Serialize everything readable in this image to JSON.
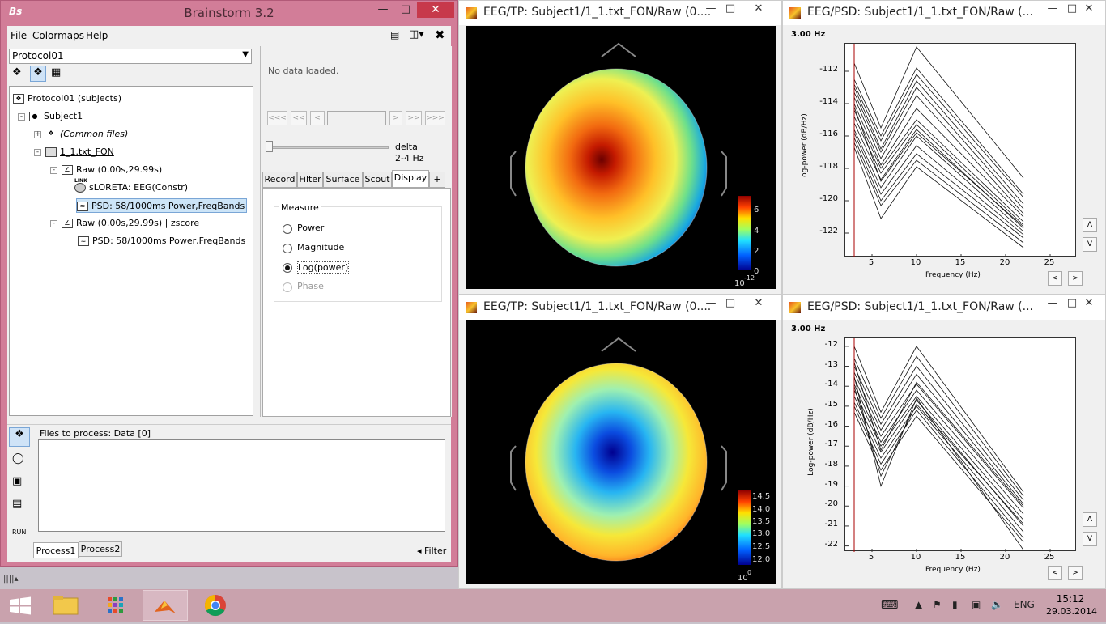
{
  "brainstorm": {
    "title": "Brainstorm 3.2",
    "menu": [
      "File",
      "Colormaps",
      "Help"
    ],
    "protocol": "Protocol01",
    "tree": {
      "root": "Protocol01 (subjects)",
      "subject": "Subject1",
      "common": "(Common files)",
      "condition": "1_1.txt_FON",
      "raw1": "Raw (0.00s,29.99s)",
      "sloreta": "sLORETA: EEG(Constr)",
      "link": "LINK",
      "psd1": "PSD: 58/1000ms Power,FreqBands",
      "raw2": "Raw (0.00s,29.99s) | zscore",
      "psd2": "PSD: 58/1000ms Power,FreqBands"
    },
    "panel": {
      "status": "No data loaded.",
      "nav": [
        "<<<",
        "<<",
        "<",
        ">",
        ">>",
        ">>>"
      ],
      "band_name": "delta",
      "band_range": "2-4 Hz",
      "tabs": [
        "Record",
        "Filter",
        "Surface",
        "Scout",
        "Display",
        "+"
      ],
      "measure_title": "Measure",
      "measures": [
        "Power",
        "Magnitude",
        "Log(power)",
        "Phase"
      ],
      "selected_measure": "Log(power)"
    },
    "process": {
      "files_label": "Files to process: Data [0]",
      "run": "RUN",
      "tabs": [
        "Process1",
        "Process2"
      ],
      "filter": "Filter"
    }
  },
  "figures": {
    "tp1": {
      "title": "EEG/TP: Subject1/1_1.txt_FON/Raw (0....",
      "colorbar_ticks": [
        "6",
        "4",
        "2",
        "0"
      ],
      "exponent_base": "10",
      "exponent": "-12"
    },
    "tp2": {
      "title": "EEG/TP: Subject1/1_1.txt_FON/Raw (0....",
      "colorbar_ticks": [
        "14.5",
        "14.0",
        "13.5",
        "13.0",
        "12.5",
        "12.0"
      ],
      "exponent_base": "10",
      "exponent": "0"
    },
    "psd1": {
      "title": "EEG/PSD: Subject1/1_1.txt_FON/Raw (...",
      "freq_label": "3.00 Hz"
    },
    "psd2": {
      "title": "EEG/PSD: Subject1/1_1.txt_FON/Raw (...",
      "freq_label": "3.00 Hz"
    }
  },
  "chart_data": [
    {
      "type": "line",
      "xlabel": "Frequency (Hz)",
      "ylabel": "Log-power  (dB/Hz)",
      "x": [
        3,
        6,
        10,
        22
      ],
      "xlim": [
        2,
        28
      ],
      "ylim": [
        -123.5,
        -110.3
      ],
      "xticks": [
        5,
        10,
        15,
        20,
        25
      ],
      "yticks": [
        -112,
        -114,
        -116,
        -118,
        -120,
        -122
      ],
      "marker_x": 3,
      "series": [
        {
          "values": [
            -111.5,
            -115.5,
            -110.5,
            -118.6
          ]
        },
        {
          "values": [
            -112.5,
            -116.0,
            -111.8,
            -119.6
          ]
        },
        {
          "values": [
            -112.8,
            -116.3,
            -112.2,
            -119.8
          ]
        },
        {
          "values": [
            -113.0,
            -116.8,
            -112.6,
            -120.2
          ]
        },
        {
          "values": [
            -113.3,
            -117.0,
            -113.0,
            -120.5
          ]
        },
        {
          "values": [
            -113.6,
            -117.4,
            -113.5,
            -120.8
          ]
        },
        {
          "values": [
            -114.0,
            -117.8,
            -114.3,
            -121.0
          ]
        },
        {
          "values": [
            -114.4,
            -118.0,
            -115.0,
            -121.3
          ]
        },
        {
          "values": [
            -114.8,
            -118.3,
            -115.3,
            -121.5
          ]
        },
        {
          "values": [
            -115.2,
            -118.7,
            -115.6,
            -121.7
          ]
        },
        {
          "values": [
            -115.6,
            -119.2,
            -116.0,
            -121.9
          ]
        },
        {
          "values": [
            -115.8,
            -119.6,
            -116.6,
            -122.1
          ]
        },
        {
          "values": [
            -116.1,
            -120.0,
            -117.1,
            -122.3
          ]
        },
        {
          "values": [
            -116.4,
            -120.3,
            -117.5,
            -122.6
          ]
        },
        {
          "values": [
            -116.7,
            -121.1,
            -117.9,
            -122.9
          ]
        },
        {
          "values": [
            -114.2,
            -118.8,
            -115.8,
            -121.6
          ]
        }
      ]
    },
    {
      "type": "line",
      "xlabel": "Frequency (Hz)",
      "ylabel": "Log-power  (dB/Hz)",
      "x": [
        3,
        6,
        10,
        22
      ],
      "xlim": [
        2,
        28
      ],
      "ylim": [
        -22.3,
        -11.6
      ],
      "xticks": [
        5,
        10,
        15,
        20,
        25
      ],
      "yticks": [
        -12,
        -13,
        -14,
        -15,
        -16,
        -17,
        -18,
        -19,
        -20,
        -21,
        -22
      ],
      "marker_x": 3,
      "series": [
        {
          "values": [
            -12.0,
            -15.3,
            -12.0,
            -19.3
          ]
        },
        {
          "values": [
            -12.6,
            -15.6,
            -12.5,
            -19.5
          ]
        },
        {
          "values": [
            -13.0,
            -15.9,
            -13.0,
            -19.7
          ]
        },
        {
          "values": [
            -13.3,
            -16.2,
            -13.4,
            -19.9
          ]
        },
        {
          "values": [
            -13.6,
            -16.5,
            -13.9,
            -20.1
          ]
        },
        {
          "values": [
            -13.9,
            -16.8,
            -14.2,
            -20.4
          ]
        },
        {
          "values": [
            -14.2,
            -17.0,
            -14.5,
            -20.7
          ]
        },
        {
          "values": [
            -14.5,
            -17.3,
            -14.7,
            -21.0
          ]
        },
        {
          "values": [
            -14.8,
            -17.6,
            -15.0,
            -21.3
          ]
        },
        {
          "values": [
            -15.0,
            -17.9,
            -15.2,
            -21.6
          ]
        },
        {
          "values": [
            -15.3,
            -18.2,
            -15.5,
            -21.8
          ]
        },
        {
          "values": [
            -13.5,
            -19.0,
            -14.6,
            -22.2
          ]
        },
        {
          "values": [
            -14.0,
            -18.5,
            -14.9,
            -20.9
          ]
        },
        {
          "values": [
            -12.8,
            -17.2,
            -13.8,
            -20.0
          ]
        }
      ]
    }
  ],
  "taskbar": {
    "lang": "ENG",
    "time": "15:12",
    "date": "29.03.2014"
  },
  "colors": {
    "window_frame": "#d27d98",
    "taskbar": "#c9a2ad",
    "close_button": "#c7394b",
    "selected_tree": "#cce4f7"
  }
}
